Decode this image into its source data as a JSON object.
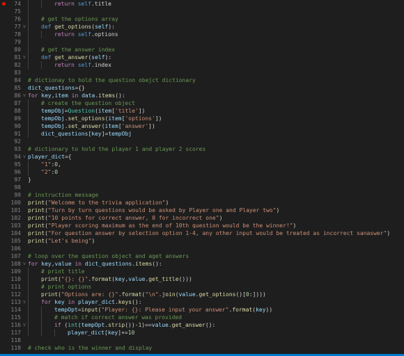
{
  "editor": {
    "colors": {
      "background": "#1e1e1e",
      "line_numbers": "#858585",
      "keyword": "#569cd6",
      "control": "#c586c0",
      "function": "#dcdcaa",
      "string": "#ce9178",
      "number": "#b5cea8",
      "comment": "#6a9955",
      "variable": "#9cdcfe",
      "text": "#d4d4d4",
      "breakpoint": "#e51400",
      "status_bar": "#007acc"
    },
    "lines": [
      {
        "n": "74",
        "bp": true,
        "fold": "",
        "indent": 2,
        "tokens": [
          [
            "ctl",
            "return "
          ],
          [
            "kw",
            "self"
          ],
          [
            "txt",
            ".title"
          ]
        ]
      },
      {
        "n": "75",
        "fold": "",
        "indent": 1,
        "tokens": []
      },
      {
        "n": "76",
        "fold": "",
        "indent": 1,
        "tokens": [
          [
            "com",
            "# get the options array"
          ]
        ]
      },
      {
        "n": "77",
        "fold": "v",
        "indent": 1,
        "tokens": [
          [
            "kw",
            "def "
          ],
          [
            "fn",
            "get_options"
          ],
          [
            "txt",
            "("
          ],
          [
            "var",
            "self"
          ],
          [
            "txt",
            "):"
          ]
        ]
      },
      {
        "n": "78",
        "fold": "",
        "indent": 2,
        "tokens": [
          [
            "ctl",
            "return "
          ],
          [
            "kw",
            "self"
          ],
          [
            "txt",
            ".options"
          ]
        ]
      },
      {
        "n": "79",
        "fold": "",
        "indent": 1,
        "tokens": []
      },
      {
        "n": "80",
        "fold": "",
        "indent": 1,
        "tokens": [
          [
            "com",
            "# get the answer index"
          ]
        ]
      },
      {
        "n": "81",
        "fold": "v",
        "indent": 1,
        "tokens": [
          [
            "kw",
            "def "
          ],
          [
            "fn",
            "get_answer"
          ],
          [
            "txt",
            "("
          ],
          [
            "var",
            "self"
          ],
          [
            "txt",
            "):"
          ]
        ]
      },
      {
        "n": "82",
        "fold": "",
        "indent": 2,
        "tokens": [
          [
            "ctl",
            "return "
          ],
          [
            "kw",
            "self"
          ],
          [
            "txt",
            ".index"
          ]
        ]
      },
      {
        "n": "83",
        "fold": "",
        "indent": 0,
        "tokens": []
      },
      {
        "n": "84",
        "fold": "",
        "indent": 0,
        "tokens": [
          [
            "com",
            "# dictionay to hold the question obejct dictionary"
          ]
        ]
      },
      {
        "n": "85",
        "fold": "",
        "indent": 0,
        "tokens": [
          [
            "var",
            "dict_questions"
          ],
          [
            "txt",
            "={}"
          ]
        ]
      },
      {
        "n": "86",
        "fold": "v",
        "indent": 0,
        "tokens": [
          [
            "ctl",
            "for "
          ],
          [
            "var",
            "key"
          ],
          [
            "txt",
            ","
          ],
          [
            "var",
            "item"
          ],
          [
            "ctl",
            " in "
          ],
          [
            "var",
            "data"
          ],
          [
            "txt",
            "."
          ],
          [
            "fn",
            "items"
          ],
          [
            "txt",
            "():"
          ]
        ]
      },
      {
        "n": "87",
        "fold": "",
        "indent": 1,
        "tokens": [
          [
            "com",
            "# create the question object"
          ]
        ]
      },
      {
        "n": "88",
        "fold": "",
        "indent": 1,
        "tokens": [
          [
            "var",
            "tempObj"
          ],
          [
            "txt",
            "="
          ],
          [
            "cls",
            "Question"
          ],
          [
            "txt",
            "("
          ],
          [
            "var",
            "item"
          ],
          [
            "txt",
            "["
          ],
          [
            "str",
            "'title'"
          ],
          [
            "txt",
            "])"
          ]
        ]
      },
      {
        "n": "89",
        "fold": "",
        "indent": 1,
        "tokens": [
          [
            "var",
            "tempObj"
          ],
          [
            "txt",
            "."
          ],
          [
            "fn",
            "set_options"
          ],
          [
            "txt",
            "("
          ],
          [
            "var",
            "item"
          ],
          [
            "txt",
            "["
          ],
          [
            "str",
            "'options'"
          ],
          [
            "txt",
            "])"
          ]
        ]
      },
      {
        "n": "90",
        "fold": "",
        "indent": 1,
        "tokens": [
          [
            "var",
            "tempObj"
          ],
          [
            "txt",
            "."
          ],
          [
            "fn",
            "set_answer"
          ],
          [
            "txt",
            "("
          ],
          [
            "var",
            "item"
          ],
          [
            "txt",
            "["
          ],
          [
            "str",
            "'answer'"
          ],
          [
            "txt",
            "])"
          ]
        ]
      },
      {
        "n": "91",
        "fold": "",
        "indent": 1,
        "tokens": [
          [
            "var",
            "dict_questions"
          ],
          [
            "txt",
            "["
          ],
          [
            "var",
            "key"
          ],
          [
            "txt",
            "]="
          ],
          [
            "var",
            "tempObj"
          ]
        ]
      },
      {
        "n": "92",
        "fold": "",
        "indent": 0,
        "tokens": []
      },
      {
        "n": "93",
        "fold": "",
        "indent": 0,
        "tokens": [
          [
            "com",
            "# dictionary to hold the player 1 and player 2 scores"
          ]
        ]
      },
      {
        "n": "94",
        "fold": "v",
        "indent": 0,
        "tokens": [
          [
            "var",
            "player_dict"
          ],
          [
            "txt",
            "={"
          ]
        ]
      },
      {
        "n": "95",
        "fold": "",
        "indent": 1,
        "tokens": [
          [
            "str",
            "\"1\""
          ],
          [
            "txt",
            ":"
          ],
          [
            "num",
            "0"
          ],
          [
            "txt",
            ","
          ]
        ]
      },
      {
        "n": "96",
        "fold": "",
        "indent": 1,
        "tokens": [
          [
            "str",
            "\"2\""
          ],
          [
            "txt",
            ":"
          ],
          [
            "num",
            "0"
          ]
        ]
      },
      {
        "n": "97",
        "fold": "",
        "indent": 0,
        "tokens": [
          [
            "txt",
            "}"
          ]
        ]
      },
      {
        "n": "98",
        "fold": "",
        "indent": 0,
        "tokens": []
      },
      {
        "n": "99",
        "fold": "",
        "indent": 0,
        "tokens": [
          [
            "com",
            "# instruction message"
          ]
        ]
      },
      {
        "n": "100",
        "fold": "",
        "indent": 0,
        "tokens": [
          [
            "fn",
            "print"
          ],
          [
            "txt",
            "("
          ],
          [
            "str",
            "\"Welcome to the trivia application\""
          ],
          [
            "txt",
            ")"
          ]
        ]
      },
      {
        "n": "101",
        "fold": "",
        "indent": 0,
        "tokens": [
          [
            "fn",
            "print"
          ],
          [
            "txt",
            "("
          ],
          [
            "str",
            "\"Turn by turn questions would be asked by Player one and Player two\""
          ],
          [
            "txt",
            ")"
          ]
        ]
      },
      {
        "n": "102",
        "fold": "",
        "indent": 0,
        "tokens": [
          [
            "fn",
            "print"
          ],
          [
            "txt",
            "("
          ],
          [
            "str",
            "\"10 points for correct answer, 0 for incorrect one\""
          ],
          [
            "txt",
            ")"
          ]
        ]
      },
      {
        "n": "103",
        "fold": "",
        "indent": 0,
        "tokens": [
          [
            "fn",
            "print"
          ],
          [
            "txt",
            "("
          ],
          [
            "str",
            "\"Player scoring maximum as the end of 10th question would be the winner!\""
          ],
          [
            "txt",
            ")"
          ]
        ]
      },
      {
        "n": "104",
        "fold": "",
        "indent": 0,
        "tokens": [
          [
            "fn",
            "print"
          ],
          [
            "txt",
            "("
          ],
          [
            "str",
            "\"For question answer by selection option 1-4, any other input would be treated as incorrect sanaswer\""
          ],
          [
            "txt",
            ")"
          ]
        ]
      },
      {
        "n": "105",
        "fold": "",
        "indent": 0,
        "tokens": [
          [
            "fn",
            "print"
          ],
          [
            "txt",
            "("
          ],
          [
            "str",
            "\"Let's being\""
          ],
          [
            "txt",
            ")"
          ]
        ]
      },
      {
        "n": "106",
        "fold": "",
        "indent": 0,
        "tokens": []
      },
      {
        "n": "107",
        "fold": "",
        "indent": 0,
        "tokens": [
          [
            "com",
            "# loop over the question object and aget answers"
          ]
        ]
      },
      {
        "n": "108",
        "fold": "v",
        "indent": 0,
        "tokens": [
          [
            "ctl",
            "for "
          ],
          [
            "var",
            "key"
          ],
          [
            "txt",
            ","
          ],
          [
            "var",
            "value"
          ],
          [
            "ctl",
            " in "
          ],
          [
            "var",
            "dict_questions"
          ],
          [
            "txt",
            "."
          ],
          [
            "fn",
            "items"
          ],
          [
            "txt",
            "():"
          ]
        ]
      },
      {
        "n": "109",
        "fold": "",
        "indent": 1,
        "tokens": [
          [
            "com",
            "# print title"
          ]
        ]
      },
      {
        "n": "110",
        "fold": "",
        "indent": 1,
        "tokens": [
          [
            "fn",
            "print"
          ],
          [
            "txt",
            "("
          ],
          [
            "str",
            "\"{}: {}\""
          ],
          [
            "txt",
            "."
          ],
          [
            "fn",
            "format"
          ],
          [
            "txt",
            "("
          ],
          [
            "var",
            "key"
          ],
          [
            "txt",
            ","
          ],
          [
            "var",
            "value"
          ],
          [
            "txt",
            "."
          ],
          [
            "fn",
            "get_title"
          ],
          [
            "txt",
            "()))"
          ]
        ]
      },
      {
        "n": "111",
        "fold": "",
        "indent": 1,
        "tokens": [
          [
            "com",
            "# print options"
          ]
        ]
      },
      {
        "n": "112",
        "fold": "",
        "indent": 1,
        "tokens": [
          [
            "fn",
            "print"
          ],
          [
            "txt",
            "("
          ],
          [
            "str",
            "\"Options are: {}\""
          ],
          [
            "txt",
            "."
          ],
          [
            "fn",
            "format"
          ],
          [
            "txt",
            "("
          ],
          [
            "str",
            "\"\\n\""
          ],
          [
            "txt",
            "."
          ],
          [
            "fn",
            "join"
          ],
          [
            "txt",
            "("
          ],
          [
            "var",
            "value"
          ],
          [
            "txt",
            "."
          ],
          [
            "fn",
            "get_options"
          ],
          [
            "txt",
            "()["
          ],
          [
            "num",
            "0"
          ],
          [
            "txt",
            ":])))"
          ]
        ]
      },
      {
        "n": "113",
        "fold": "v",
        "indent": 1,
        "tokens": [
          [
            "ctl",
            "for "
          ],
          [
            "var",
            "key"
          ],
          [
            "ctl",
            " in "
          ],
          [
            "var",
            "player_dict"
          ],
          [
            "txt",
            "."
          ],
          [
            "fn",
            "keys"
          ],
          [
            "txt",
            "():"
          ]
        ]
      },
      {
        "n": "114",
        "fold": "",
        "indent": 2,
        "tokens": [
          [
            "var",
            "tempOpt"
          ],
          [
            "txt",
            "="
          ],
          [
            "fn",
            "input"
          ],
          [
            "txt",
            "("
          ],
          [
            "str",
            "\"Player: {}: Please input your answer\""
          ],
          [
            "txt",
            "."
          ],
          [
            "fn",
            "format"
          ],
          [
            "txt",
            "("
          ],
          [
            "var",
            "key"
          ],
          [
            "txt",
            "))"
          ]
        ]
      },
      {
        "n": "115",
        "fold": "",
        "indent": 2,
        "tokens": [
          [
            "com",
            "# match if correct answer was provided"
          ]
        ]
      },
      {
        "n": "116",
        "fold": "v",
        "indent": 2,
        "tokens": [
          [
            "ctl",
            "if "
          ],
          [
            "txt",
            "("
          ],
          [
            "cls",
            "int"
          ],
          [
            "txt",
            "("
          ],
          [
            "var",
            "tempOpt"
          ],
          [
            "txt",
            "."
          ],
          [
            "fn",
            "strip"
          ],
          [
            "txt",
            "())-"
          ],
          [
            "num",
            "1"
          ],
          [
            "txt",
            ")=="
          ],
          [
            "var",
            "value"
          ],
          [
            "txt",
            "."
          ],
          [
            "fn",
            "get_answer"
          ],
          [
            "txt",
            "():"
          ]
        ]
      },
      {
        "n": "117",
        "fold": "",
        "indent": 3,
        "tokens": [
          [
            "var",
            "player_dict"
          ],
          [
            "txt",
            "["
          ],
          [
            "var",
            "key"
          ],
          [
            "txt",
            "]+="
          ],
          [
            "num",
            "10"
          ]
        ]
      },
      {
        "n": "118",
        "fold": "",
        "indent": 0,
        "tokens": []
      },
      {
        "n": "119",
        "fold": "",
        "indent": 0,
        "tokens": [
          [
            "com",
            "# check who is the winner and display"
          ]
        ]
      }
    ]
  }
}
